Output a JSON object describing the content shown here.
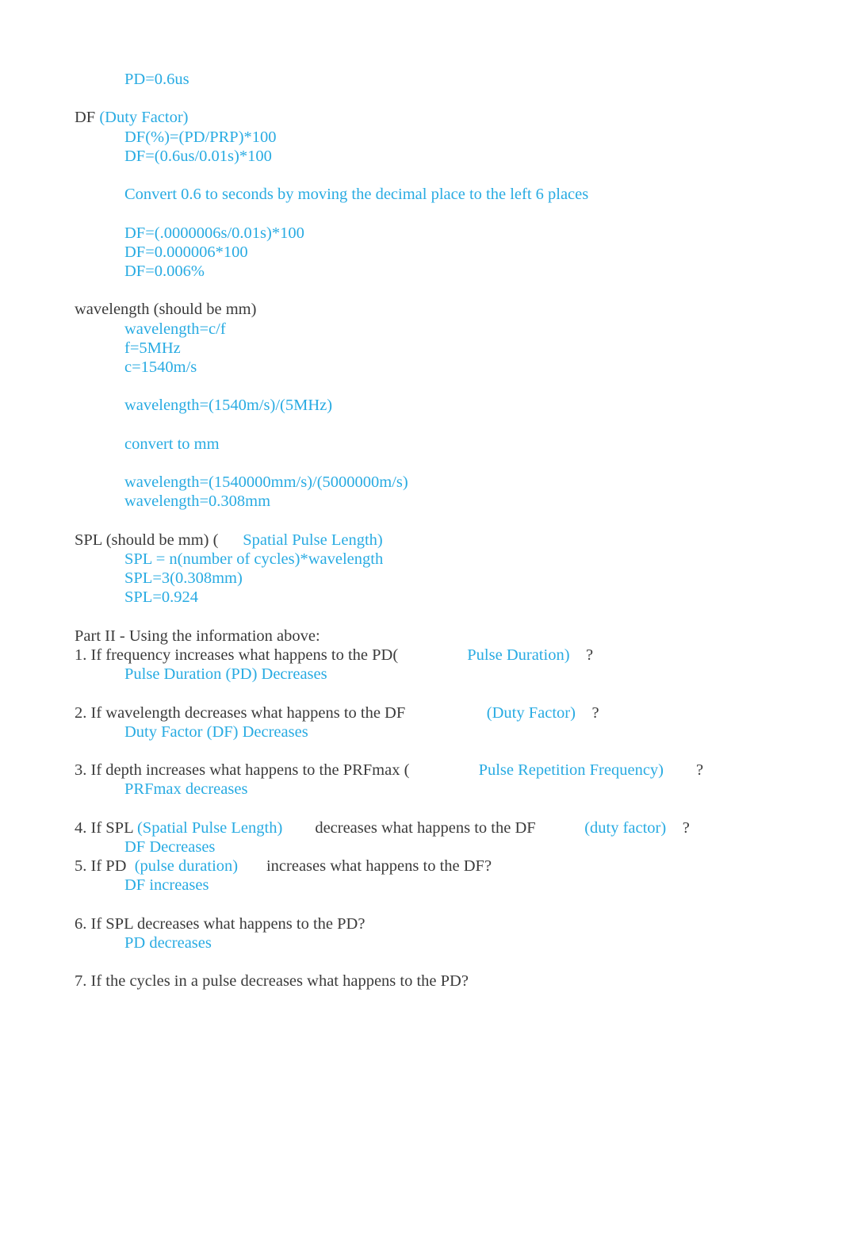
{
  "document": {
    "colors": {
      "accent_cyan": "#29ABE2",
      "body_text": "#3b3b3b",
      "background": "#ffffff"
    },
    "blocks": [
      {
        "id": "pd-value",
        "lines": [
          {
            "indent": true,
            "segments": [
              {
                "text": "PD=0.6us",
                "color": "cyan"
              }
            ]
          }
        ]
      },
      {
        "id": "spacer-1",
        "lines": [
          {
            "blank": true
          }
        ]
      },
      {
        "id": "duty-factor",
        "lines": [
          {
            "indent": false,
            "segments": [
              {
                "text": "DF ",
                "color": "black"
              },
              {
                "text": "(Duty Factor)",
                "color": "cyan"
              }
            ]
          },
          {
            "indent": true,
            "segments": [
              {
                "text": "DF(%)=(PD/PRP)*100",
                "color": "cyan"
              }
            ]
          },
          {
            "indent": true,
            "segments": [
              {
                "text": "DF=(0.6us/0.01s)*100",
                "color": "cyan"
              }
            ]
          },
          {
            "blank": true
          },
          {
            "indent": true,
            "segments": [
              {
                "text": "Convert 0.6 to seconds by moving the decimal place to the left 6 places",
                "color": "cyan"
              }
            ]
          },
          {
            "blank": true
          },
          {
            "indent": true,
            "segments": [
              {
                "text": "DF=(.0000006s/0.01s)*100",
                "color": "cyan"
              }
            ]
          },
          {
            "indent": true,
            "segments": [
              {
                "text": "DF=0.000006*100",
                "color": "cyan"
              }
            ]
          },
          {
            "indent": true,
            "segments": [
              {
                "text": "DF=0.006%",
                "color": "cyan"
              }
            ]
          }
        ]
      },
      {
        "id": "spacer-2",
        "lines": [
          {
            "blank": true
          }
        ]
      },
      {
        "id": "wavelength",
        "lines": [
          {
            "indent": false,
            "segments": [
              {
                "text": "wavelength (should be mm)",
                "color": "black"
              }
            ]
          },
          {
            "indent": true,
            "segments": [
              {
                "text": "wavelength=c/f",
                "color": "cyan"
              }
            ]
          },
          {
            "indent": true,
            "segments": [
              {
                "text": "f=5MHz",
                "color": "cyan"
              }
            ]
          },
          {
            "indent": true,
            "segments": [
              {
                "text": "c=1540m/s",
                "color": "cyan"
              }
            ]
          },
          {
            "blank": true
          },
          {
            "indent": true,
            "segments": [
              {
                "text": "wavelength=(1540m/s)/(5MHz)",
                "color": "cyan"
              }
            ]
          },
          {
            "blank": true
          },
          {
            "indent": true,
            "segments": [
              {
                "text": "convert to mm",
                "color": "cyan"
              }
            ]
          },
          {
            "blank": true
          },
          {
            "indent": true,
            "segments": [
              {
                "text": "wavelength=(1540000mm/s)/(5000000m/s)",
                "color": "cyan"
              }
            ]
          },
          {
            "indent": true,
            "segments": [
              {
                "text": "wavelength=0.308mm",
                "color": "cyan"
              }
            ]
          }
        ]
      },
      {
        "id": "spacer-3",
        "lines": [
          {
            "blank": true
          }
        ]
      },
      {
        "id": "spl",
        "lines": [
          {
            "indent": false,
            "segments": [
              {
                "text": "SPL (should be mm) (",
                "color": "black"
              },
              {
                "text": "      Spatial Pulse Length)",
                "color": "cyan"
              }
            ]
          },
          {
            "indent": true,
            "segments": [
              {
                "text": "SPL = n(number of cycles)*wavelength",
                "color": "cyan"
              }
            ]
          },
          {
            "indent": true,
            "segments": [
              {
                "text": "SPL=3(0.308mm)",
                "color": "cyan"
              }
            ]
          },
          {
            "indent": true,
            "segments": [
              {
                "text": "SPL=0.924",
                "color": "cyan"
              }
            ]
          }
        ]
      },
      {
        "id": "spacer-4",
        "lines": [
          {
            "blank": true
          }
        ]
      },
      {
        "id": "part-two",
        "lines": [
          {
            "indent": false,
            "segments": [
              {
                "text": "Part II - Using the information above:",
                "color": "black"
              }
            ]
          },
          {
            "indent": false,
            "segments": [
              {
                "text": "1. If frequency increases what happens to the PD(",
                "color": "black"
              },
              {
                "text": "                 Pulse Duration)",
                "color": "cyan"
              },
              {
                "text": "    ?",
                "color": "black"
              }
            ]
          },
          {
            "indent": true,
            "segments": [
              {
                "text": "Pulse Duration (PD) Decreases",
                "color": "cyan"
              }
            ]
          },
          {
            "blank": true
          },
          {
            "indent": false,
            "segments": [
              {
                "text": "2. If wavelength decreases what happens to the DF",
                "color": "black"
              },
              {
                "text": "                    (Duty Factor)",
                "color": "cyan"
              },
              {
                "text": "    ?",
                "color": "black"
              }
            ]
          },
          {
            "indent": true,
            "segments": [
              {
                "text": "Duty Factor (DF) Decreases",
                "color": "cyan"
              }
            ]
          },
          {
            "blank": true
          },
          {
            "indent": false,
            "segments": [
              {
                "text": "3. If depth increases what happens to the PRFmax (",
                "color": "black"
              },
              {
                "text": "                 Pulse Repetition Frequency)",
                "color": "cyan"
              },
              {
                "text": "        ?",
                "color": "black"
              }
            ]
          },
          {
            "indent": true,
            "segments": [
              {
                "text": "PRFmax decreases",
                "color": "cyan"
              }
            ]
          },
          {
            "blank": true
          },
          {
            "indent": false,
            "segments": [
              {
                "text": "4. If SPL ",
                "color": "black"
              },
              {
                "text": "(Spatial Pulse Length)",
                "color": "cyan"
              },
              {
                "text": "        decreases what happens to the DF",
                "color": "black"
              },
              {
                "text": "            (duty factor)",
                "color": "cyan"
              },
              {
                "text": "    ?",
                "color": "black"
              }
            ]
          },
          {
            "indent": true,
            "segments": [
              {
                "text": "DF Decreases",
                "color": "cyan"
              }
            ]
          },
          {
            "indent": false,
            "segments": [
              {
                "text": "5. If PD ",
                "color": "black"
              },
              {
                "text": " (pulse duration)",
                "color": "cyan"
              },
              {
                "text": "       increases what happens to the DF?",
                "color": "black"
              }
            ]
          },
          {
            "indent": true,
            "segments": [
              {
                "text": "DF increases",
                "color": "cyan"
              }
            ]
          },
          {
            "blank": true
          },
          {
            "indent": false,
            "segments": [
              {
                "text": "6. If SPL decreases what happens to the PD?",
                "color": "black"
              }
            ]
          },
          {
            "indent": true,
            "segments": [
              {
                "text": "PD decreases",
                "color": "cyan"
              }
            ]
          },
          {
            "blank": true
          },
          {
            "indent": false,
            "segments": [
              {
                "text": "7. If the cycles in a pulse decreases what happens to the PD?",
                "color": "black"
              }
            ]
          }
        ]
      }
    ]
  }
}
